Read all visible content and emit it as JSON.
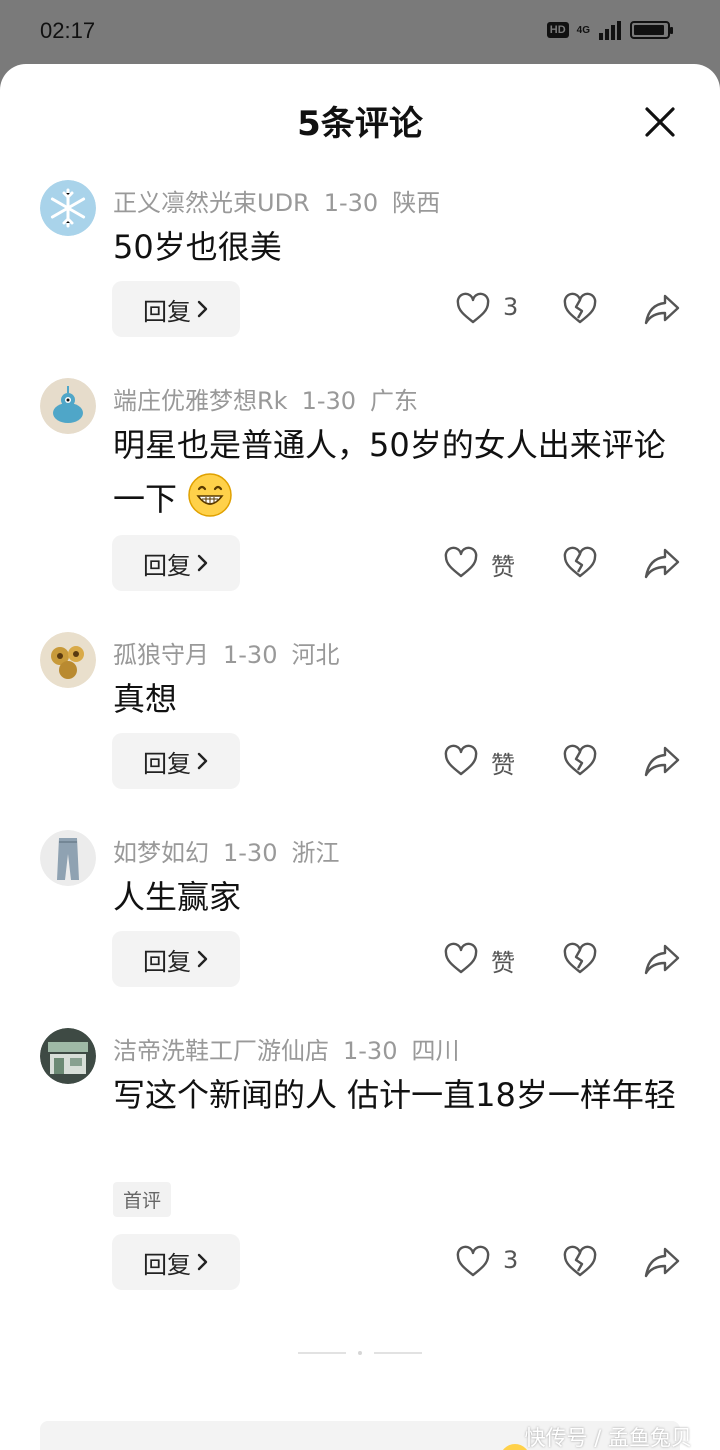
{
  "status_bar": {
    "time": "02:17",
    "hd": "HD",
    "network": "4G"
  },
  "sheet": {
    "title": "5条评论"
  },
  "comments": [
    {
      "username": "正义凛然光束UDR",
      "date": "1-30",
      "location": "陕西",
      "text": "50岁也很美",
      "tag": "",
      "reply_label": "回复",
      "like_label": "3"
    },
    {
      "username": "端庄优雅梦想Rk",
      "date": "1-30",
      "location": "广东",
      "text": "明星也是普通人，50岁的女人出来评论一下",
      "tag": "",
      "reply_label": "回复",
      "like_label": "赞"
    },
    {
      "username": "孤狼守月",
      "date": "1-30",
      "location": "河北",
      "text": "真想",
      "tag": "",
      "reply_label": "回复",
      "like_label": "赞"
    },
    {
      "username": "如梦如幻",
      "date": "1-30",
      "location": "浙江",
      "text": "人生赢家",
      "tag": "",
      "reply_label": "回复",
      "like_label": "赞"
    },
    {
      "username": "洁帝洗鞋工厂游仙店",
      "date": "1-30",
      "location": "四川",
      "text": "写这个新闻的人 估计一直18岁一样年轻",
      "tag": "首评",
      "reply_label": "回复",
      "like_label": "3"
    }
  ],
  "watermark": "快传号 / 孟鱼兔贝",
  "icons": {
    "close": "close-icon",
    "chevron": "chevron-right-icon",
    "like": "heart-icon",
    "dislike": "broken-heart-icon",
    "share": "share-arrow-icon",
    "emoji": "grin-emoji-icon"
  },
  "colors": {
    "meta_text": "#999999",
    "button_bg": "#f3f3f3",
    "icon": "#555555",
    "status_bg": "#7a7a7a"
  }
}
